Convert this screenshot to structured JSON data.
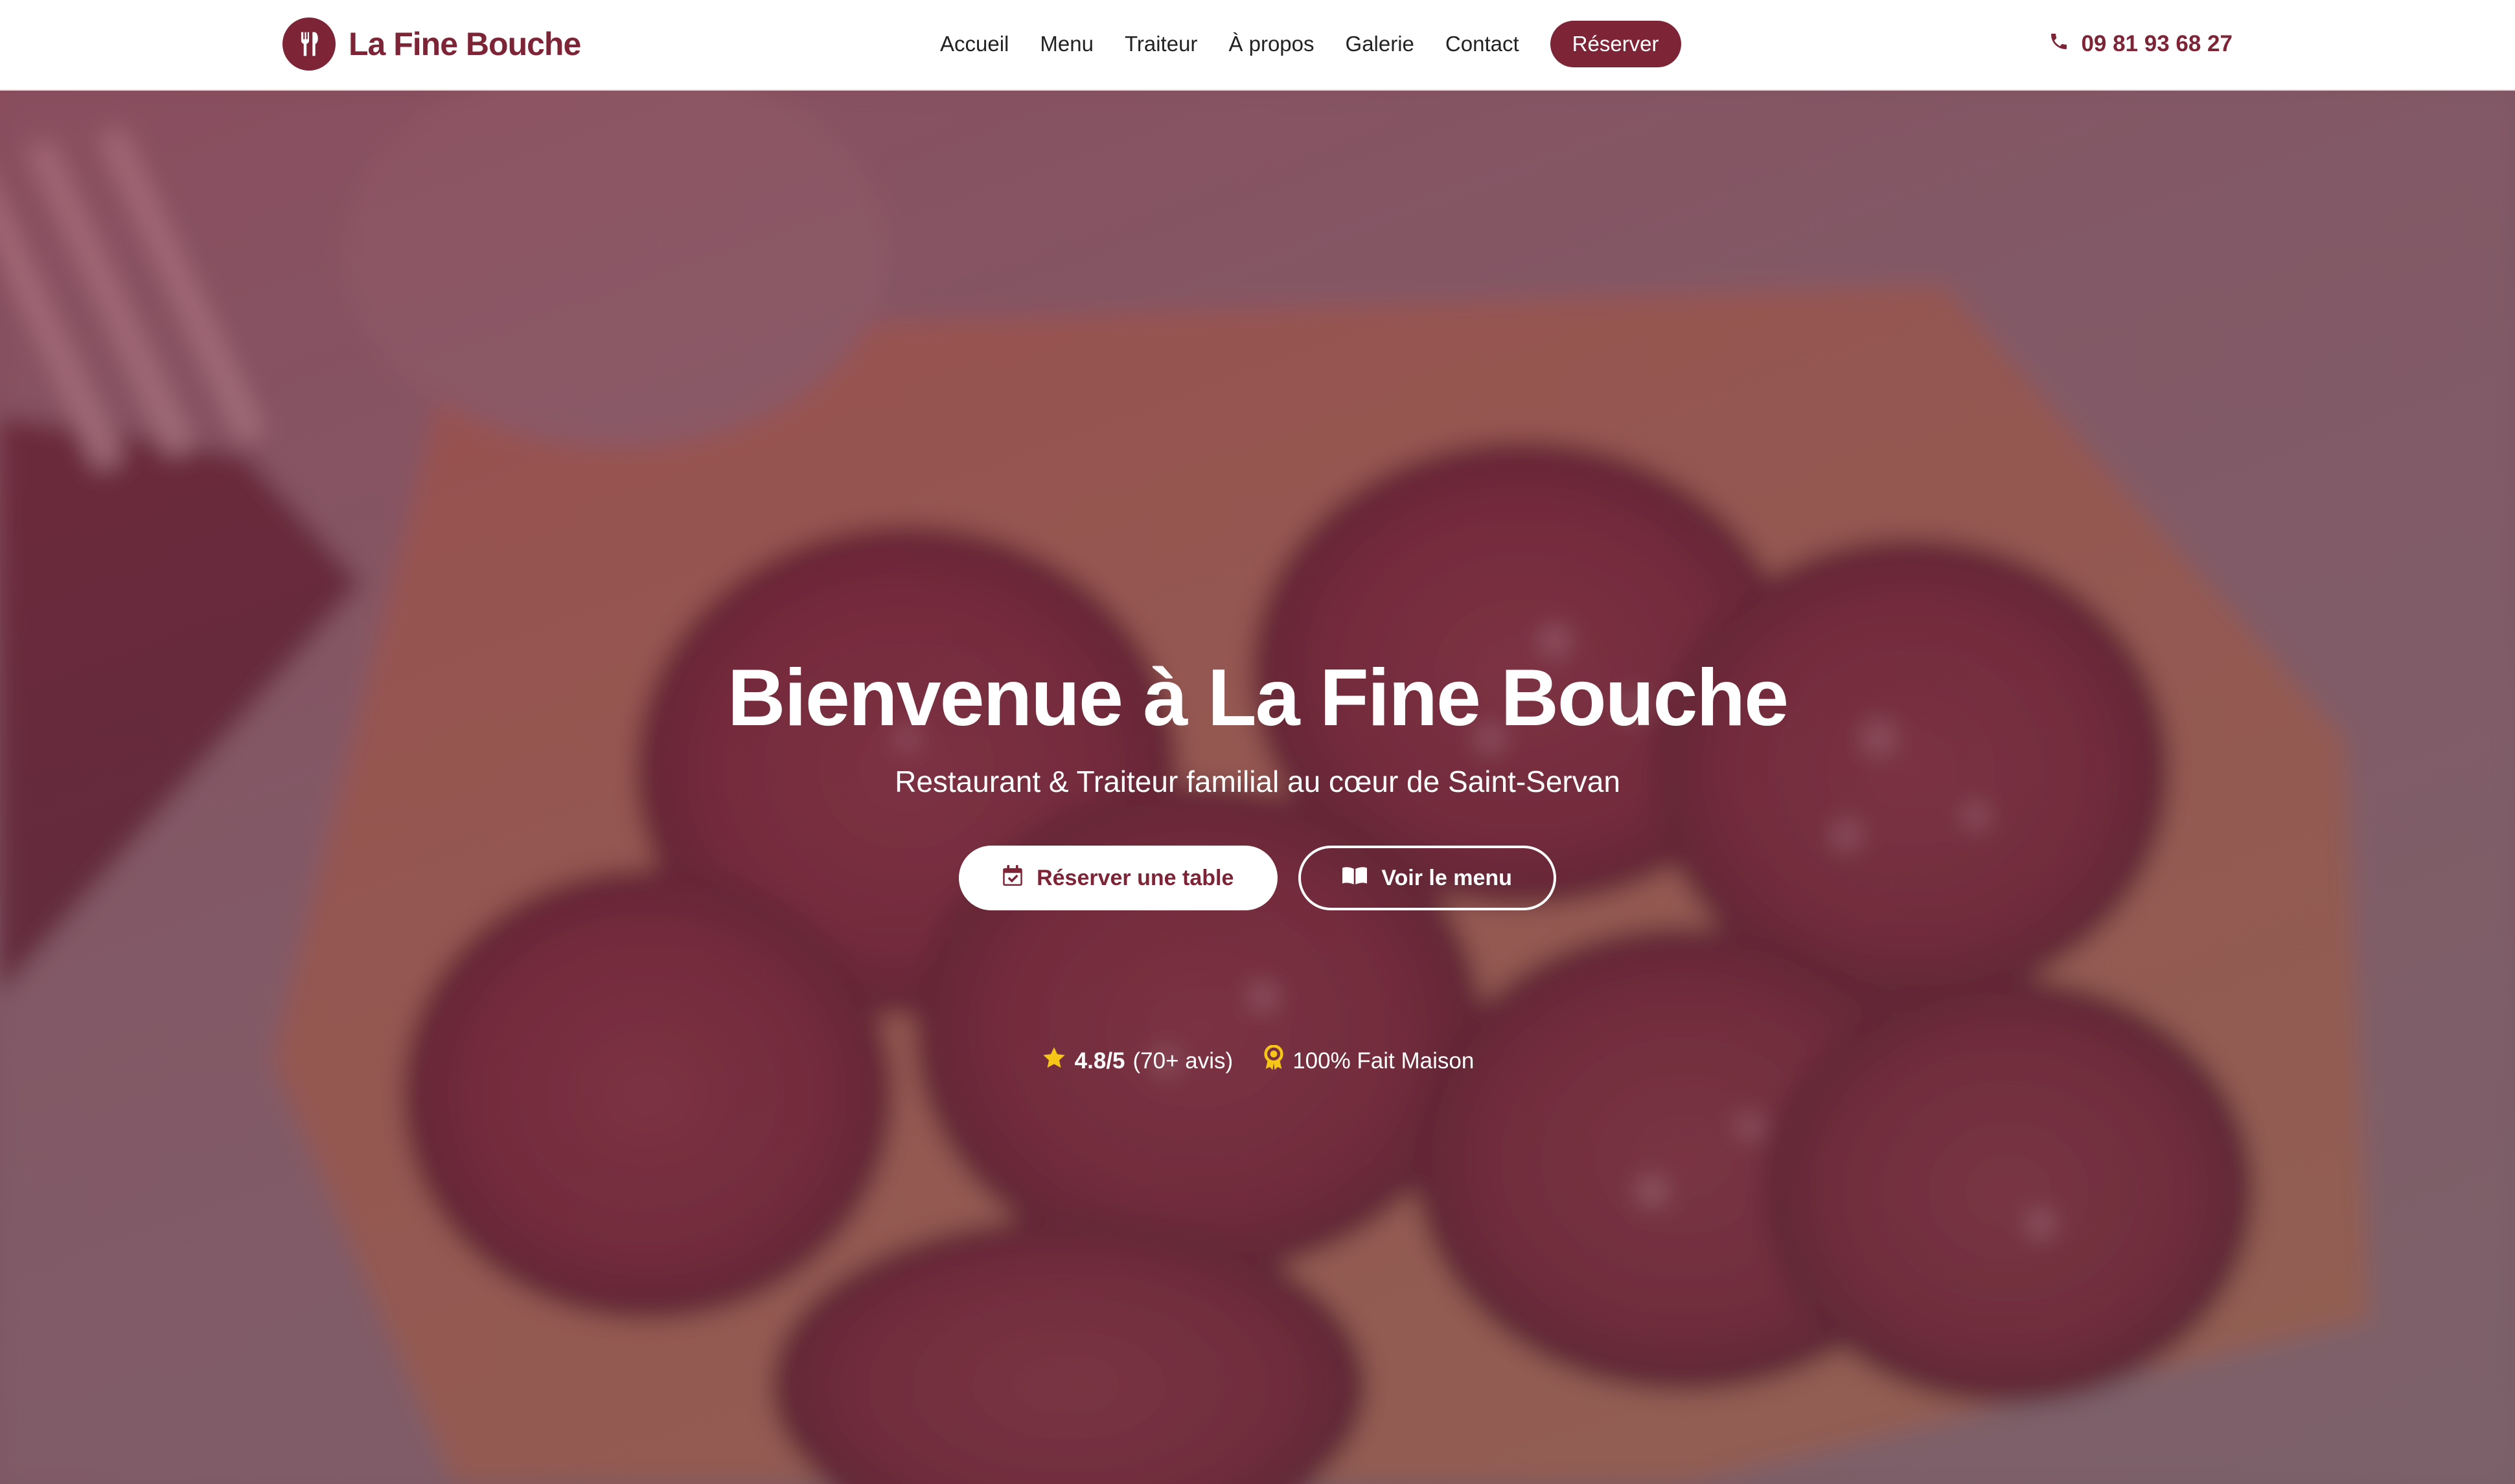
{
  "brand": {
    "name": "La Fine Bouche",
    "logo_icon": "utensils-icon",
    "color": "#7d2437"
  },
  "nav": {
    "links": [
      {
        "label": "Accueil"
      },
      {
        "label": "Menu"
      },
      {
        "label": "Traiteur"
      },
      {
        "label": "À propos"
      },
      {
        "label": "Galerie"
      },
      {
        "label": "Contact"
      }
    ],
    "reserve_label": "Réserver",
    "phone": "09 81 93 68 27",
    "phone_icon": "phone-icon"
  },
  "hero": {
    "background": "charcuterie-board-photo",
    "title": "Bienvenue à La Fine Bouche",
    "subtitle": "Restaurant & Traiteur familial au cœur de Saint-Servan",
    "primary_button": {
      "label": "Réserver une table",
      "icon": "calendar-check-icon"
    },
    "secondary_button": {
      "label": "Voir le menu",
      "icon": "book-open-icon"
    },
    "rating": {
      "score": "4.8/5",
      "count": "(70+ avis)",
      "icon": "star-icon",
      "icon_color": "#f5c518"
    },
    "homemade": {
      "label": "100% Fait Maison",
      "icon": "award-icon",
      "icon_color": "#f5c518"
    }
  }
}
